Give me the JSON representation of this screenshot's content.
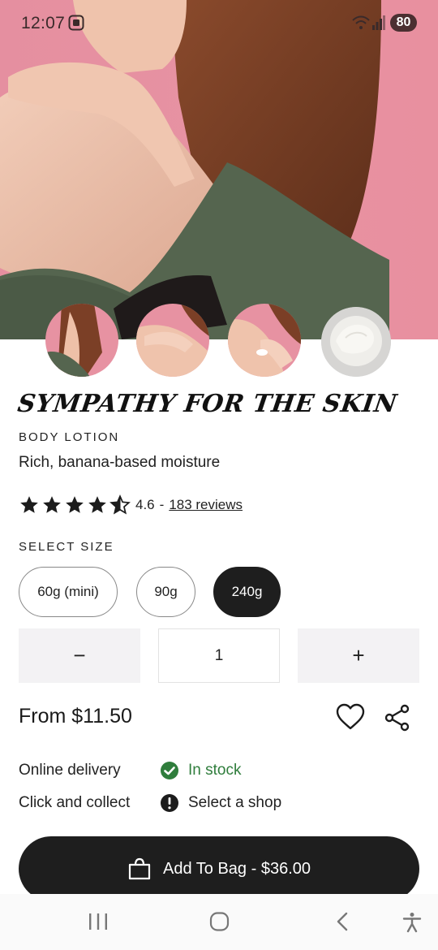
{
  "status_bar": {
    "time": "12:07",
    "battery": "80",
    "icons": [
      "screenshot-icon",
      "wifi-icon",
      "signal-icon",
      "battery-icon"
    ]
  },
  "gallery": {
    "thumbnails": [
      "model-thumbnail-1",
      "model-thumbnail-2",
      "model-thumbnail-3",
      "product-pot-thumbnail"
    ]
  },
  "product": {
    "title": "SYMPATHY FOR THE SKIN",
    "category": "BODY LOTION",
    "tagline": "Rich, banana-based moisture",
    "rating": {
      "value": 4.6,
      "score_text": "4.6",
      "separator": "-",
      "reviews_text": "183 reviews",
      "max_stars": 5
    },
    "size_label": "SELECT SIZE",
    "sizes": [
      {
        "label": "60g (mini)",
        "selected": false
      },
      {
        "label": "90g",
        "selected": false
      },
      {
        "label": "240g",
        "selected": true
      }
    ],
    "quantity": {
      "minus": "−",
      "value": "1",
      "plus": "+"
    },
    "price": "From $11.50",
    "availability": [
      {
        "label": "Online delivery",
        "status": "In stock",
        "icon": "check-circle-icon"
      },
      {
        "label": "Click and collect",
        "status": "Select a shop",
        "icon": "exclamation-circle-icon"
      }
    ],
    "add_to_bag": "Add To Bag - $36.00"
  },
  "colors": {
    "hero_pink": "#e792a2",
    "button_dark": "#1e1e1e",
    "in_stock_green": "#2f7d3c",
    "qty_bg": "#f3f2f4"
  },
  "nav_bar": {
    "icons": [
      "recent-apps-icon",
      "home-icon",
      "back-icon",
      "accessibility-icon"
    ]
  }
}
